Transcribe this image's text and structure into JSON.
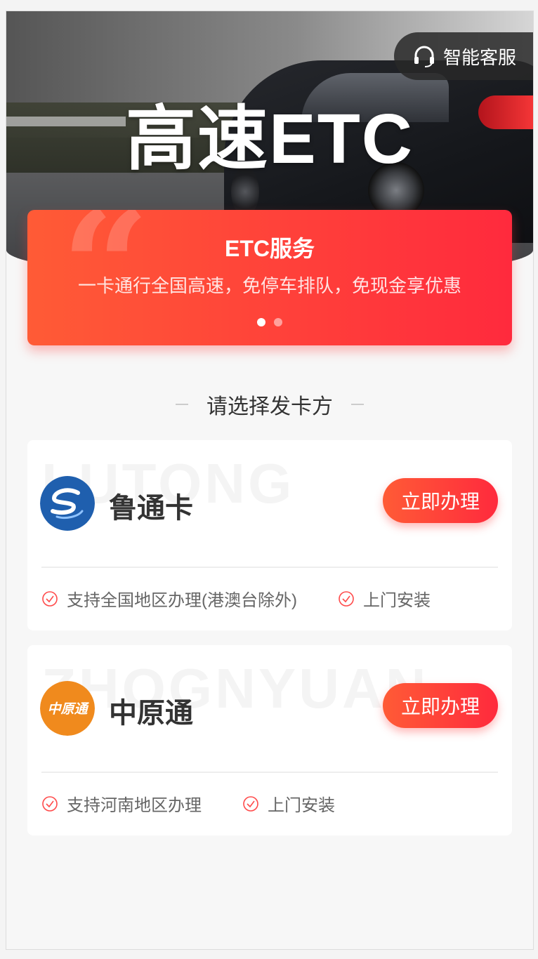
{
  "hero": {
    "title": "高速ETC",
    "service_label": "智能客服"
  },
  "banner": {
    "title": "ETC服务",
    "subtitle": "一卡通行全国高速，免停车排队，免现金享优惠",
    "slides_total": 2,
    "active_slide": 1
  },
  "section": {
    "title": "请选择发卡方"
  },
  "cards": [
    {
      "watermark": "LUTONG",
      "name": "鲁通卡",
      "apply_label": "立即办理",
      "logo_color": "#1f5fae",
      "features": [
        "支持全国地区办理(港澳台除外)",
        "上门安装"
      ]
    },
    {
      "watermark": "ZHOGNYUAN",
      "name": "中原通",
      "apply_label": "立即办理",
      "logo_color": "#f08a1d",
      "logo_text": "中原通",
      "features": [
        "支持河南地区办理",
        "上门安装"
      ]
    }
  ],
  "colors": {
    "accent_start": "#ff5b36",
    "accent_end": "#ff2a3d",
    "check": "#ff4a4a"
  }
}
